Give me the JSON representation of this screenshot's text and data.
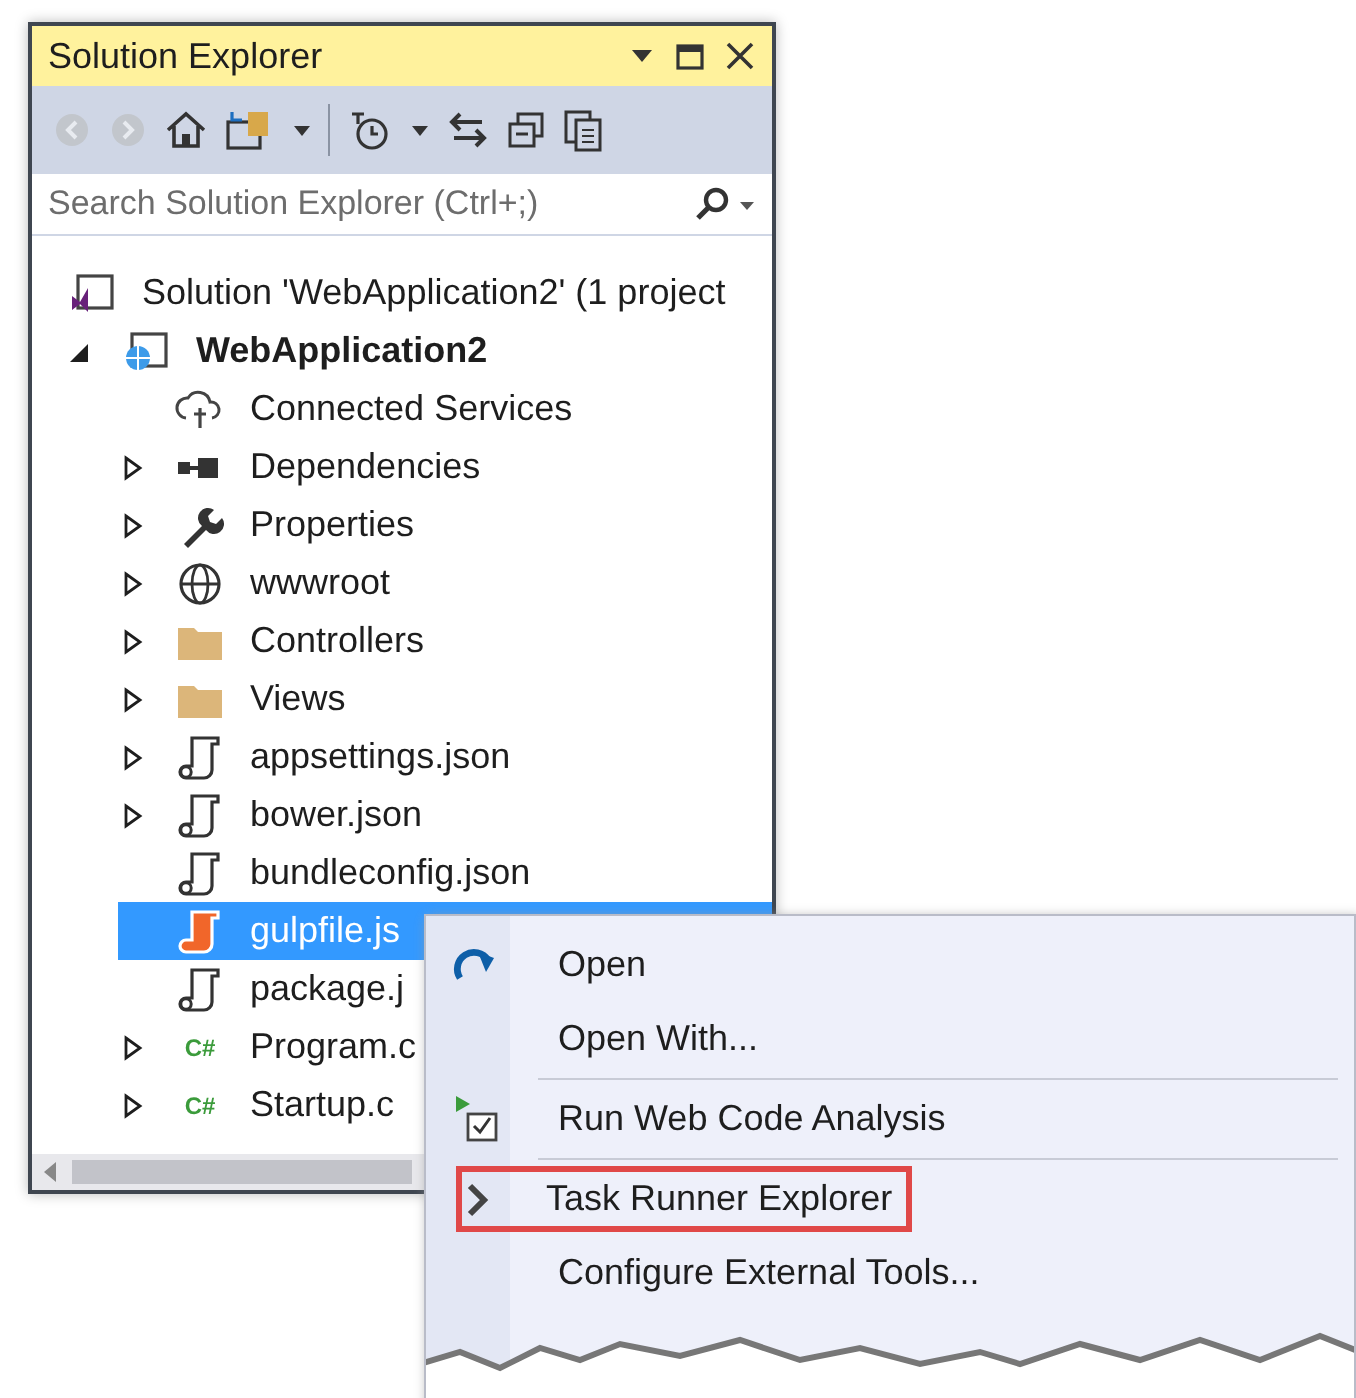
{
  "panel": {
    "title": "Solution Explorer",
    "search": {
      "placeholder": "Search Solution Explorer (Ctrl+;)"
    }
  },
  "tree": [
    {
      "label": "Solution 'WebApplication2' (1 project",
      "kind": "solution",
      "bold": false,
      "selected": false,
      "children": [
        {
          "label": "WebApplication2",
          "kind": "project",
          "bold": true,
          "selected": false,
          "expanded": true,
          "children": [
            {
              "label": "Connected Services",
              "kind": "cloud",
              "bold": false,
              "selected": false
            },
            {
              "label": "Dependencies",
              "kind": "dependencies",
              "bold": false,
              "selected": false,
              "expanded": false
            },
            {
              "label": "Properties",
              "kind": "wrench",
              "bold": false,
              "selected": false,
              "expanded": false
            },
            {
              "label": "wwwroot",
              "kind": "globe",
              "bold": false,
              "selected": false,
              "expanded": false
            },
            {
              "label": "Controllers",
              "kind": "folder",
              "bold": false,
              "selected": false,
              "expanded": false
            },
            {
              "label": "Views",
              "kind": "folder",
              "bold": false,
              "selected": false,
              "expanded": false
            },
            {
              "label": "appsettings.json",
              "kind": "json",
              "bold": false,
              "selected": false,
              "expanded": false
            },
            {
              "label": "bower.json",
              "kind": "json",
              "bold": false,
              "selected": false,
              "expanded": false
            },
            {
              "label": "bundleconfig.json",
              "kind": "json",
              "bold": false,
              "selected": false
            },
            {
              "label": "gulpfile.js",
              "kind": "gulp",
              "bold": false,
              "selected": true
            },
            {
              "label": "package.j",
              "kind": "json",
              "bold": false,
              "selected": false
            },
            {
              "label": "Program.c",
              "kind": "cs",
              "badge": "C#",
              "bold": false,
              "selected": false,
              "expanded": false
            },
            {
              "label": "Startup.c",
              "kind": "cs",
              "badge": "C#",
              "bold": false,
              "selected": false,
              "expanded": false
            }
          ]
        }
      ]
    }
  ],
  "context_menu": [
    {
      "label": "Open",
      "kind": "redo",
      "separator_before": false,
      "outlined": false
    },
    {
      "label": "Open With...",
      "kind": "plain",
      "separator_before": false,
      "outlined": false
    },
    {
      "label": "Run Web Code Analysis",
      "kind": "check",
      "separator_before": true,
      "outlined": false
    },
    {
      "label": "Task Runner Explorer",
      "kind": "chevron",
      "separator_before": true,
      "outlined": true
    },
    {
      "label": "Configure External Tools...",
      "kind": "plain",
      "separator_before": false,
      "outlined": false
    }
  ]
}
